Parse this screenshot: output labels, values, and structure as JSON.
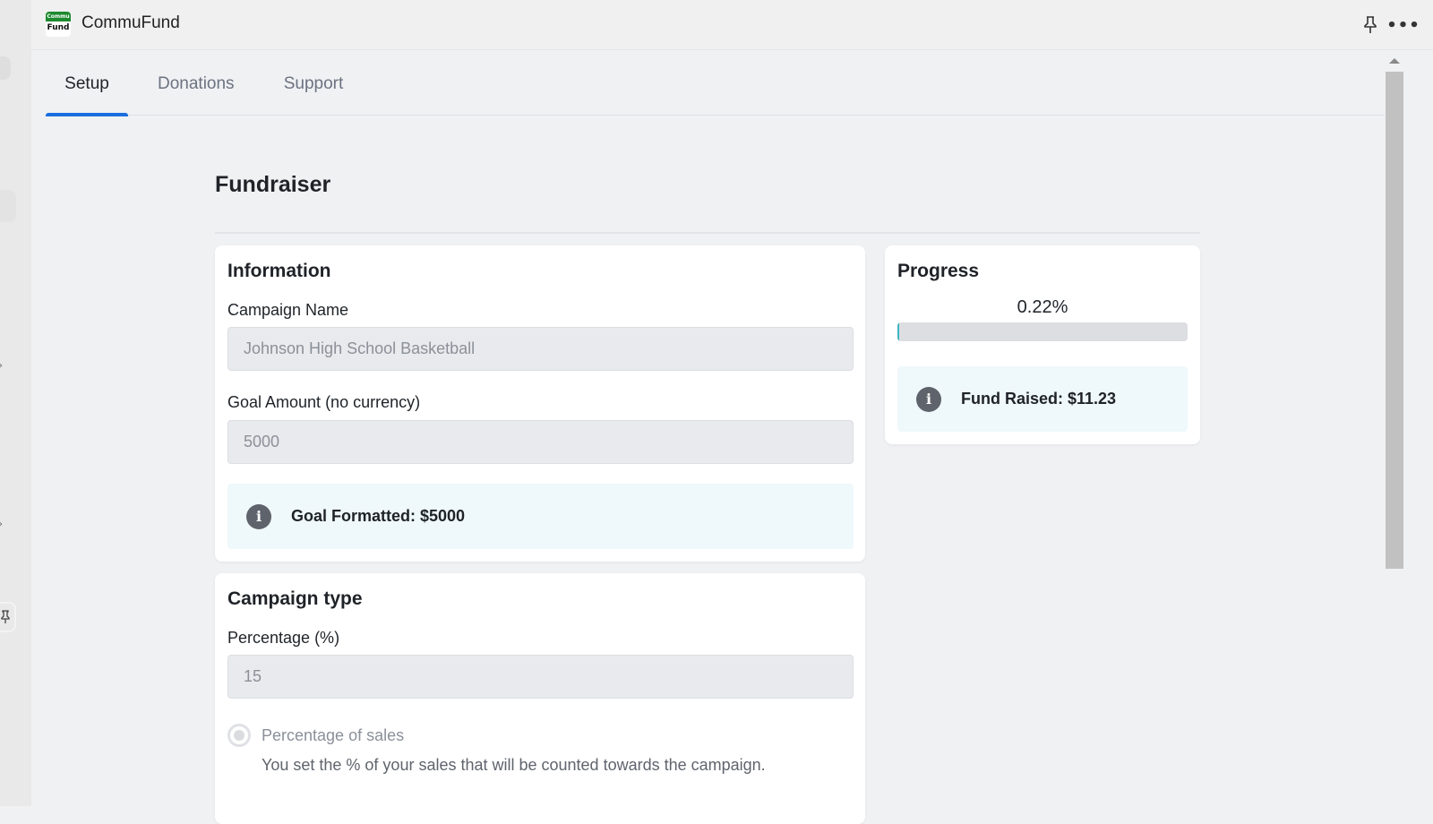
{
  "app": {
    "title": "CommuFund",
    "logo_top": "Commu",
    "logo_bottom": "Fund",
    "pin_icon": "pin-icon",
    "more_icon": "more-horizontal-icon",
    "more_glyph": "•••"
  },
  "tabs": [
    {
      "label": "Setup",
      "active": true
    },
    {
      "label": "Donations",
      "active": false
    },
    {
      "label": "Support",
      "active": false
    }
  ],
  "page": {
    "title": "Fundraiser"
  },
  "information": {
    "title": "Information",
    "campaign_name_label": "Campaign Name",
    "campaign_name_value": "Johnson High School Basketball",
    "goal_label": "Goal Amount (no currency)",
    "goal_value": "5000",
    "goal_notice": "Goal Formatted: $5000",
    "info_glyph": "i"
  },
  "progress": {
    "title": "Progress",
    "percent_label": "0.22%",
    "percent_value": 0.22,
    "fund_notice": "Fund Raised: $11.23",
    "info_glyph": "i",
    "colors": {
      "track": "#dcdee2",
      "fill": "#3fb6c0"
    }
  },
  "campaign_type": {
    "title": "Campaign type",
    "percentage_label": "Percentage (%)",
    "percentage_value": "15",
    "option_label": "Percentage of sales",
    "option_selected": true,
    "option_help": "You set the % of your sales that will be counted towards the campaign."
  },
  "colors": {
    "accent": "#1a6fe0",
    "notice_bg": "#eff8fb",
    "logo_green": "#1e8a2e"
  }
}
